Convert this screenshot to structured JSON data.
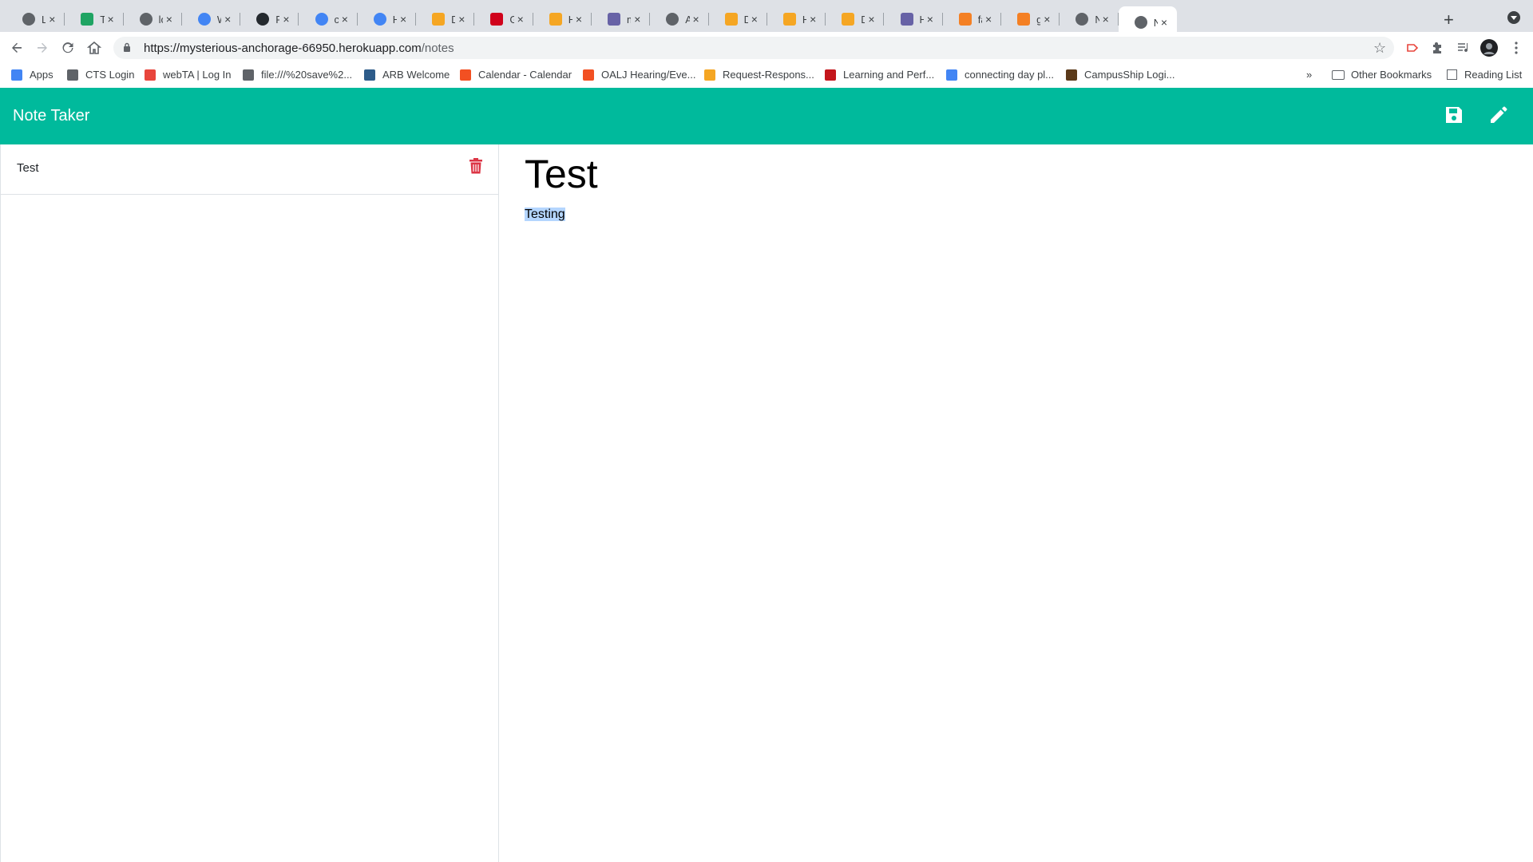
{
  "browser": {
    "tabs": [
      {
        "title": "Logi",
        "favicon": "globe-icon",
        "color": "#5f6368"
      },
      {
        "title": "Tean",
        "favicon": "drive-icon",
        "color": "#1fa463"
      },
      {
        "title": "local",
        "favicon": "globe-icon",
        "color": "#5f6368"
      },
      {
        "title": "Wha",
        "favicon": "google-icon",
        "color": "#4285f4"
      },
      {
        "title": "Page",
        "favicon": "github-icon",
        "color": "#24292e"
      },
      {
        "title": "cont",
        "favicon": "google-icon",
        "color": "#4285f4"
      },
      {
        "title": "How",
        "favicon": "google-icon",
        "color": "#4285f4"
      },
      {
        "title": "Depl",
        "favicon": "fs-icon",
        "color": "#f5a623"
      },
      {
        "title": "Gett",
        "favicon": "ict-icon",
        "color": "#d0021b"
      },
      {
        "title": "How",
        "favicon": "fs-icon",
        "color": "#f5a623"
      },
      {
        "title": "mys",
        "favicon": "heroku-icon",
        "color": "#6762a6"
      },
      {
        "title": "Appl",
        "favicon": "globe-icon",
        "color": "#5f6368"
      },
      {
        "title": "Depl",
        "favicon": "fs-icon",
        "color": "#f5a623"
      },
      {
        "title": "How",
        "favicon": "fs-icon",
        "color": "#f5a623"
      },
      {
        "title": "Depl",
        "favicon": "fs-icon",
        "color": "#f5a623"
      },
      {
        "title": "Herc",
        "favicon": "heroku-icon",
        "color": "#6762a6"
      },
      {
        "title": "faile",
        "favicon": "stackoverflow-icon",
        "color": "#f48024"
      },
      {
        "title": "git -",
        "favicon": "stackoverflow-icon",
        "color": "#f48024"
      },
      {
        "title": "New",
        "favicon": "globe-icon",
        "color": "#5f6368"
      },
      {
        "title": "Note",
        "favicon": "globe-icon",
        "color": "#5f6368",
        "active": true
      }
    ],
    "url": {
      "host": "https://mysterious-anchorage-66950.herokuapp.com",
      "path": "/notes"
    },
    "bookmarks": [
      {
        "label": "Apps",
        "color": "#4285f4"
      },
      {
        "label": "CTS Login",
        "color": "#5f6368"
      },
      {
        "label": "webTA | Log In",
        "color": "#e8453c"
      },
      {
        "label": "file:///%20save%2...",
        "color": "#5f6368"
      },
      {
        "label": "ARB Welcome",
        "color": "#2d5c8a"
      },
      {
        "label": "Calendar - Calendar",
        "color": "#f25022"
      },
      {
        "label": "OALJ Hearing/Eve...",
        "color": "#f25022"
      },
      {
        "label": "Request-Respons...",
        "color": "#f5a623"
      },
      {
        "label": "Learning and Perf...",
        "color": "#c4161c"
      },
      {
        "label": "connecting day pl...",
        "color": "#4285f4"
      },
      {
        "label": "CampusShip Logi...",
        "color": "#5b3a1a"
      }
    ],
    "bookmarks_overflow": "»",
    "other_bookmarks": "Other Bookmarks",
    "reading_list": "Reading List"
  },
  "app": {
    "brand": "Note Taker",
    "accent": "#00ba9c",
    "notes": [
      {
        "title": "Test"
      }
    ],
    "active_note": {
      "title": "Test",
      "text": "Testing"
    }
  }
}
